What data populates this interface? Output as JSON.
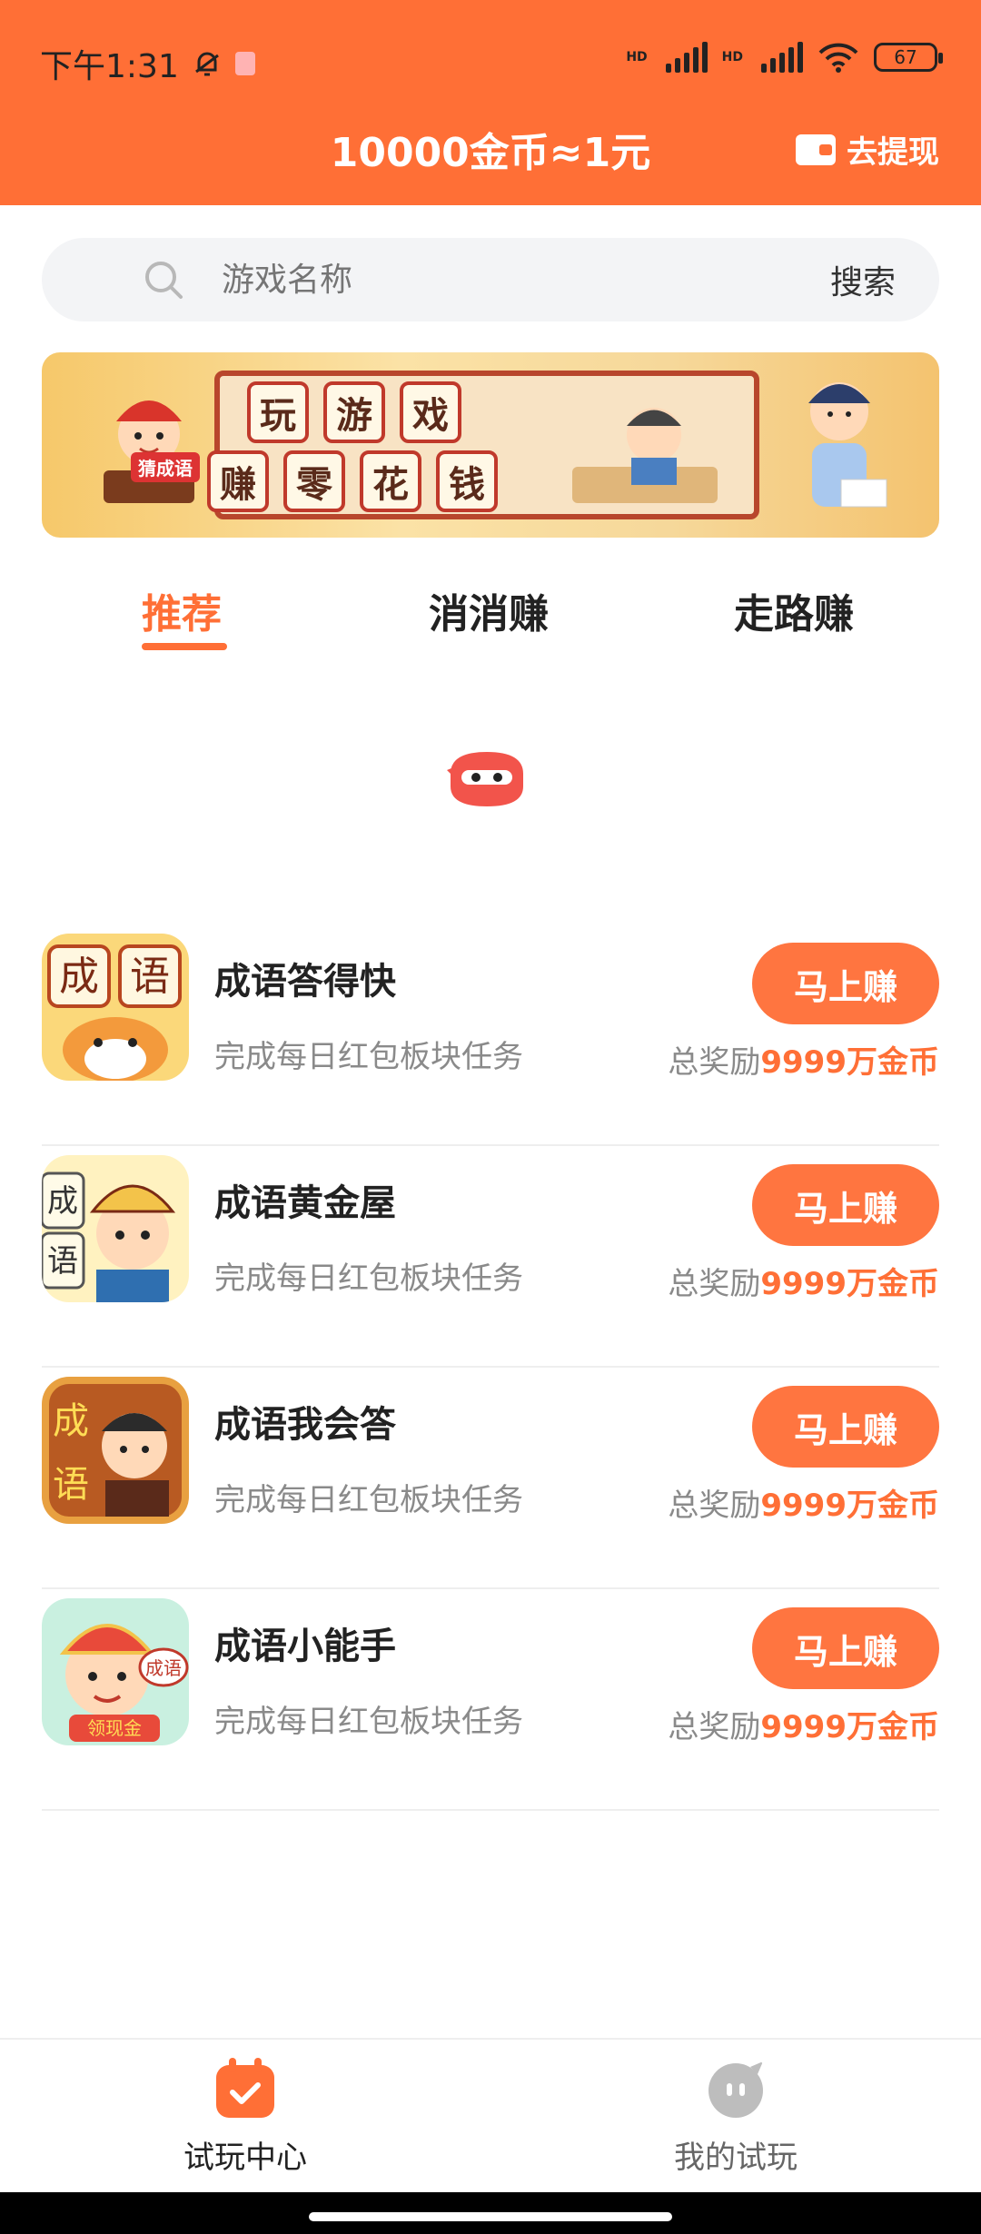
{
  "status_bar": {
    "time": "下午1:31",
    "battery": "67",
    "net1": "HD",
    "net2": "HD"
  },
  "header": {
    "title": "10000金币≈1元",
    "withdraw_label": "去提现"
  },
  "search": {
    "placeholder": "游戏名称",
    "button_label": "搜索"
  },
  "banner": {
    "row1": [
      "玩",
      "游",
      "戏"
    ],
    "row2": [
      "赚",
      "零",
      "花",
      "钱"
    ],
    "badge": "猜成语"
  },
  "tabs": [
    {
      "label": "推荐",
      "active": true
    },
    {
      "label": "消消赚",
      "active": false
    },
    {
      "label": "走路赚",
      "active": false
    }
  ],
  "games": [
    {
      "name": "成语答得快",
      "desc": "完成每日红包板块任务",
      "button": "马上赚",
      "reward_prefix": "总奖励",
      "reward_value": "9999万金币",
      "icon_text": [
        "成",
        "语"
      ],
      "icon_colors": [
        "#ffe9a8",
        "#f4b24a"
      ]
    },
    {
      "name": "成语黄金屋",
      "desc": "完成每日红包板块任务",
      "button": "马上赚",
      "reward_prefix": "总奖励",
      "reward_value": "9999万金币",
      "icon_text": [
        "成",
        "语"
      ],
      "icon_colors": [
        "#fff2c0",
        "#f3c34a"
      ]
    },
    {
      "name": "成语我会答",
      "desc": "完成每日红包板块任务",
      "button": "马上赚",
      "reward_prefix": "总奖励",
      "reward_value": "9999万金币",
      "icon_text": [
        "成",
        "语"
      ],
      "icon_colors": [
        "#e8a040",
        "#a24a1c"
      ]
    },
    {
      "name": "成语小能手",
      "desc": "完成每日红包板块任务",
      "button": "马上赚",
      "reward_prefix": "总奖励",
      "reward_value": "9999万金币",
      "icon_text": [
        "成语",
        "领现金"
      ],
      "icon_colors": [
        "#c9f0e0",
        "#e84a3a"
      ]
    }
  ],
  "bottom_nav": [
    {
      "label": "试玩中心",
      "active": true,
      "icon": "calendar-check-icon"
    },
    {
      "label": "我的试玩",
      "active": false,
      "icon": "chat-bubble-icon"
    }
  ],
  "colors": {
    "accent": "#ff6f36",
    "button": "#ff7540",
    "muted": "#8a8a8a"
  }
}
